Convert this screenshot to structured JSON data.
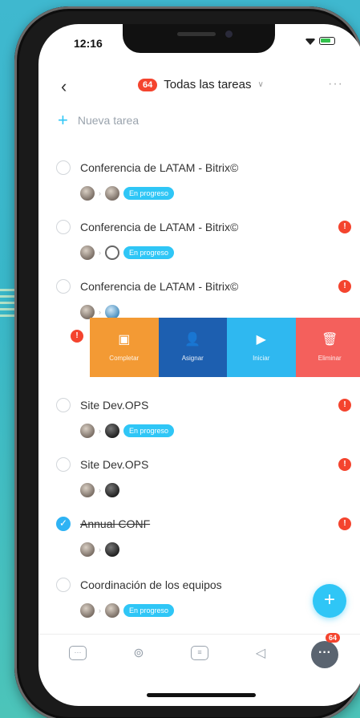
{
  "status_bar": {
    "time": "12:16"
  },
  "header": {
    "badge": "64",
    "title": "Todas las tareas",
    "more": "···"
  },
  "new_task": {
    "label": "Nueva tarea"
  },
  "tasks": [
    {
      "name": "Conferencia de LATAM - Bitrix©",
      "status": "En progreso"
    },
    {
      "name": "Conferencia de LATAM - Bitrix©",
      "status": "En progreso",
      "alert": "!"
    },
    {
      "name": "Conferencia de LATAM - Bitrix©",
      "alert": "!"
    },
    {
      "name": "Site Dev.OPS",
      "status": "En progreso",
      "alert": "!"
    },
    {
      "name": "Site Dev.OPS",
      "alert": "!"
    },
    {
      "name": "Annual CONF",
      "alert": "!"
    },
    {
      "name": "Coordinación de los equipos",
      "status": "En progreso"
    }
  ],
  "swipe_actions": {
    "alert": "!",
    "complete": "Completar",
    "assign": "Asignar",
    "start": "Iniciar",
    "delete": "Eliminar"
  },
  "tab_bar": {
    "more_badge": "64"
  },
  "colors": {
    "accent": "#2fc6f6",
    "alert": "#f4442e",
    "complete": "#f39a34",
    "assign": "#1d5fb0",
    "start": "#2fb8f0",
    "delete": "#f4605c"
  }
}
